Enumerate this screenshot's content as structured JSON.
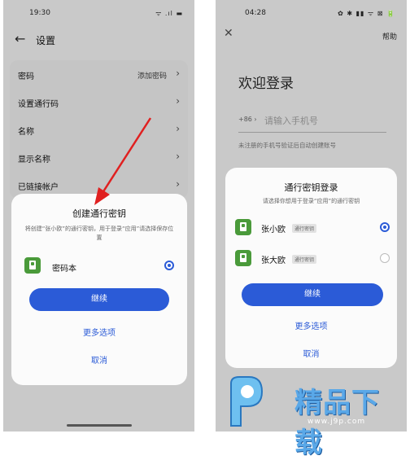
{
  "left": {
    "status_time": "19:30",
    "status_icons": "ᯤ .ıl ▬",
    "header_title": "设置",
    "list": [
      {
        "label": "密码",
        "value": "添加密码"
      },
      {
        "label": "设置通行码",
        "value": ""
      },
      {
        "label": "名称",
        "value": ""
      },
      {
        "label": "显示名称",
        "value": ""
      },
      {
        "label": "已链接帐户",
        "value": ""
      }
    ],
    "sheet": {
      "title": "创建通行密钥",
      "description": "将创建“张小欧”的通行密钥，用于登录“应用”请选择保存位置",
      "option_name": "密码本",
      "continue": "继续",
      "more": "更多选项",
      "cancel": "取消"
    }
  },
  "right": {
    "status_time": "04:28",
    "status_icons": "✿ ✱ ▮▮ ᯤ ⊠ 🔋",
    "help": "帮助",
    "welcome": "欢迎登录",
    "country_code": "+86 ›",
    "phone_placeholder": "请输入手机号",
    "hint": "未注册的手机号验证后自动创建账号",
    "sheet": {
      "title": "通行密钥登录",
      "description": "请选择你想用于登录“应用”的通行密钥",
      "accounts": [
        {
          "name": "张小欧",
          "tag": "通行密钥",
          "selected": true
        },
        {
          "name": "张大欧",
          "tag": "通行密钥",
          "selected": false
        }
      ],
      "continue": "继续",
      "more": "更多选项",
      "cancel": "取消"
    }
  },
  "watermark": {
    "brand": "精品下载",
    "url": "www.j9p.com"
  },
  "colors": {
    "accent": "#2b5bd7",
    "arrow": "#e02020",
    "app_icon": "#4a9a3a",
    "dim_background": "#c9c9c9"
  }
}
